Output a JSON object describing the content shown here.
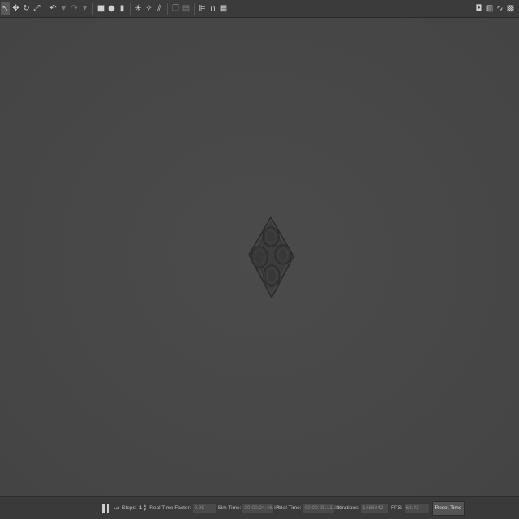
{
  "toolbar": {
    "left_tools": [
      {
        "icon": "arrow-select-icon",
        "glyph": "↖",
        "selected": true,
        "dim": false
      },
      {
        "icon": "translate-icon",
        "glyph": "✥",
        "selected": false,
        "dim": false
      },
      {
        "icon": "rotate-icon",
        "glyph": "↻",
        "selected": false,
        "dim": false
      },
      {
        "icon": "scale-icon",
        "glyph": "⤢",
        "selected": false,
        "dim": false
      },
      {
        "sep": true
      },
      {
        "icon": "undo-icon",
        "glyph": "↶",
        "selected": false,
        "dim": false
      },
      {
        "icon": "undo-dropdown-icon",
        "glyph": "▾",
        "selected": false,
        "dim": true
      },
      {
        "icon": "redo-icon",
        "glyph": "↷",
        "selected": false,
        "dim": true
      },
      {
        "icon": "redo-dropdown-icon",
        "glyph": "▾",
        "selected": false,
        "dim": true
      },
      {
        "sep": true
      },
      {
        "icon": "box-shape-icon",
        "glyph": "■",
        "selected": false,
        "dim": false
      },
      {
        "icon": "sphere-shape-icon",
        "glyph": "●",
        "selected": false,
        "dim": false
      },
      {
        "icon": "cylinder-shape-icon",
        "glyph": "▮",
        "selected": false,
        "dim": false
      },
      {
        "sep": true
      },
      {
        "icon": "point-light-icon",
        "glyph": "✳",
        "selected": false,
        "dim": false
      },
      {
        "icon": "spot-light-icon",
        "glyph": "✧",
        "selected": false,
        "dim": false
      },
      {
        "icon": "directional-light-icon",
        "glyph": "⫽",
        "selected": false,
        "dim": false
      },
      {
        "sep": true
      },
      {
        "icon": "copy-icon",
        "glyph": "❐",
        "selected": false,
        "dim": true
      },
      {
        "icon": "paste-icon",
        "glyph": "▤",
        "selected": false,
        "dim": true
      },
      {
        "sep": true
      },
      {
        "icon": "align-icon",
        "glyph": "⊫",
        "selected": false,
        "dim": false
      },
      {
        "icon": "snap-icon",
        "glyph": "∩",
        "selected": false,
        "dim": false
      },
      {
        "icon": "change-view-icon",
        "glyph": "▦",
        "selected": false,
        "dim": false
      }
    ],
    "right_tools": [
      {
        "icon": "screenshot-icon",
        "glyph": "◘"
      },
      {
        "icon": "log-icon",
        "glyph": "▥"
      },
      {
        "icon": "plot-icon",
        "glyph": "∿"
      },
      {
        "icon": "record-video-icon",
        "glyph": "▩"
      }
    ]
  },
  "statusbar": {
    "steps_label": "Steps:",
    "steps_value": "1",
    "real_time_factor_label": "Real Time Factor:",
    "real_time_factor_value": "0.99",
    "sim_time_label": "Sim Time:",
    "sim_time_value": "00 00:24:48.842",
    "real_time_label": "Real Time:",
    "real_time_value": "00 00:25:13.333",
    "iterations_label": "Iterations:",
    "iterations_value": "1488842",
    "fps_label": "FPS:",
    "fps_value": "62.43",
    "reset_time_label": "Reset Time"
  },
  "colors": {
    "viewport_bg": "#474747",
    "toolbar_bg": "#3b3b3b",
    "statusbar_bg": "#3a3a3a",
    "model_fill": "#3c3c3c",
    "model_edge": "#2b2b2b"
  }
}
